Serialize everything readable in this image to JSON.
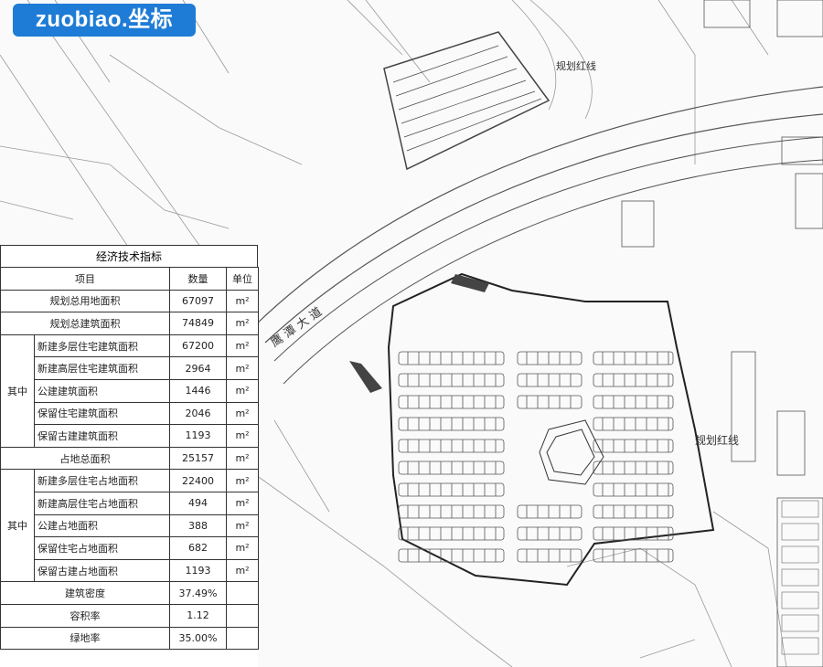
{
  "logo": {
    "text": "zuobiao.坐标"
  },
  "plan": {
    "redline_label_top": "规划红线",
    "redline_label_right": "规划红线",
    "road_label": "鹰 潭 大 道"
  },
  "table": {
    "title": "经济技术指标",
    "headers": {
      "item": "项目",
      "qty": "数量",
      "unit": "单位"
    },
    "rows": [
      {
        "item": "规划总用地面积",
        "value": "67097",
        "unit": "m²"
      },
      {
        "item": "规划总建筑面积",
        "value": "74849",
        "unit": "m²"
      }
    ],
    "group1": {
      "label": "其中",
      "rows": [
        {
          "item": "新建多层住宅建筑面积",
          "value": "67200",
          "unit": "m²"
        },
        {
          "item": "新建高层住宅建筑面积",
          "value": "2964",
          "unit": "m²"
        },
        {
          "item": "公建建筑面积",
          "value": "1446",
          "unit": "m²"
        },
        {
          "item": "保留住宅建筑面积",
          "value": "2046",
          "unit": "m²"
        },
        {
          "item": "保留古建建筑面积",
          "value": "1193",
          "unit": "m²"
        }
      ]
    },
    "occupied": {
      "item": "占地总面积",
      "value": "25157",
      "unit": "m²"
    },
    "group2": {
      "label": "其中",
      "rows": [
        {
          "item": "新建多层住宅占地面积",
          "value": "22400",
          "unit": "m²"
        },
        {
          "item": "新建高层住宅占地面积",
          "value": "494",
          "unit": "m²"
        },
        {
          "item": "公建占地面积",
          "value": "388",
          "unit": "m²"
        },
        {
          "item": "保留住宅占地面积",
          "value": "682",
          "unit": "m²"
        },
        {
          "item": "保留古建占地面积",
          "value": "1193",
          "unit": "m²"
        }
      ]
    },
    "density": {
      "item": "建筑密度",
      "value": "37.49%"
    },
    "far": {
      "item": "容积率",
      "value": "1.12"
    },
    "green": {
      "item": "绿地率",
      "value": "35.00%"
    }
  }
}
